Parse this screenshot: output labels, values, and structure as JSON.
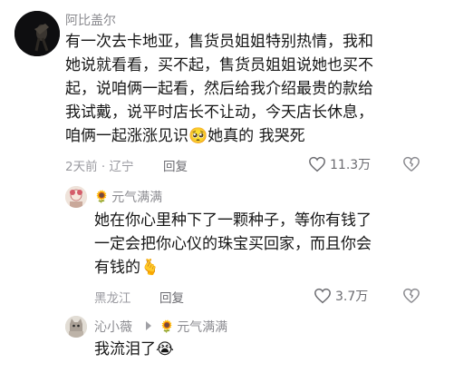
{
  "comments": [
    {
      "author": "阿比盖尔",
      "lines": [
        "有一次去卡地亚，售货员姐姐特别热情，我和",
        "她说就看看，买不起，售货员姐姐说她也买不",
        "起，说咱俩一起看，然后给我介绍最贵的款给",
        "我试戴，说平时店长不让动，今天店长休息，",
        "咱俩一起涨涨见识"
      ],
      "last_line_tail": "她真的 我哭死",
      "emoji": "🥺",
      "time_location": "2天前 · 辽宁",
      "reply_label": "回复",
      "likes": "11.3万"
    },
    {
      "author": "元气满满",
      "lines": [
        "她在你心里种下了一颗种子，等你有钱了",
        "一定会把你心仪的珠宝买回家，而且你会",
        "有钱的"
      ],
      "emoji": "🫰",
      "location": "黑龙江",
      "reply_label": "回复",
      "likes": "3.7万"
    },
    {
      "author": "沁小薇",
      "replied_to": "元气满满",
      "text": "我流泪了",
      "emoji": "😭"
    }
  ]
}
